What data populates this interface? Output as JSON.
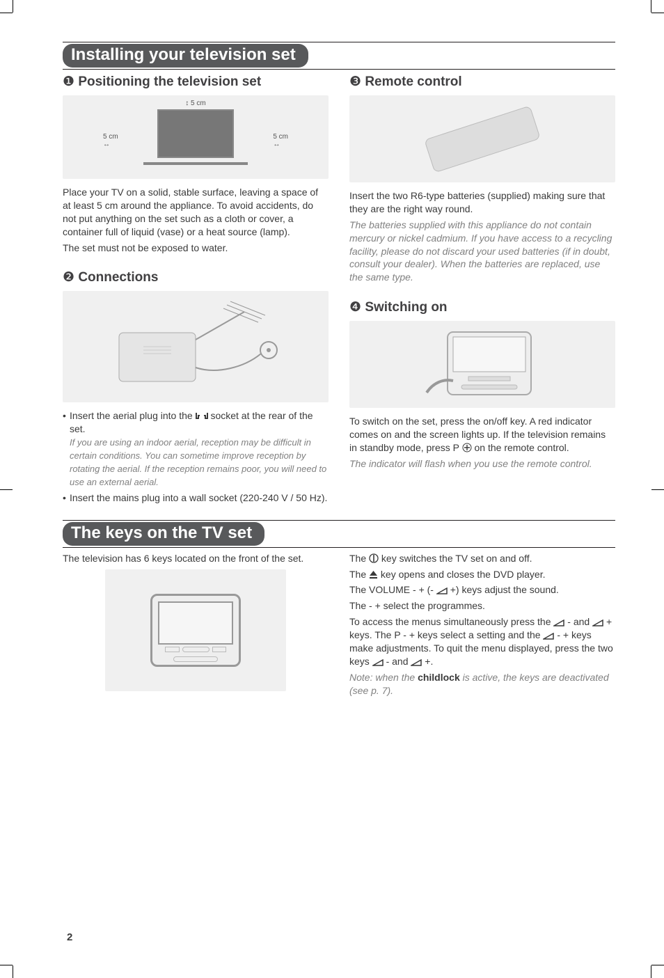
{
  "section1": {
    "title": "Installing your television set",
    "left": {
      "heading_num": "❶",
      "heading": "Positioning the television set",
      "dim_top": "5 cm",
      "dim_left": "5 cm",
      "dim_right": "5 cm",
      "p1": "Place your TV on a solid, stable surface, leaving a space of at least 5 cm around the appliance. To avoid accidents, do not put anything on the set such as a cloth or cover, a container full of liquid (vase) or a heat source (lamp).",
      "p2": "The set must not be exposed to water."
    },
    "left2": {
      "heading_num": "❷",
      "heading": "Connections",
      "b1_a": "Insert the aerial plug into the ",
      "b1_b": " socket at the rear of the set.",
      "b1_italic": "If you are using an indoor aerial, reception may be difficult in certain conditions. You can sometime improve reception by rotating the aerial. If the reception remains poor, you will need to use an external aerial.",
      "b2": "Insert the mains plug into a wall socket (220-240 V / 50 Hz)."
    },
    "right": {
      "heading_num": "❸",
      "heading": "Remote control",
      "p1": "Insert the two R6-type batteries (supplied) making sure that they are the right way round.",
      "p_italic": "The batteries supplied with this appliance do not contain mercury or nickel cadmium. If you have access to a recycling facility, please do not discard your used batteries (if in doubt, consult your dealer). When the batteries are replaced, use the same type."
    },
    "right2": {
      "heading_num": "❹",
      "heading": "Switching on",
      "p1": "To switch on the set, press the on/off key. A red indicator comes on and the screen lights up. If the television remains in standby mode, press P ",
      "p1b": " on the remote control.",
      "p_italic": "The indicator will flash when you use the remote control."
    }
  },
  "section2": {
    "title": "The keys on the TV set",
    "left": {
      "p1": "The television has 6 keys located on the front of the set."
    },
    "right": {
      "l1a": "The ",
      "l1b": " key switches the TV set on and off.",
      "l2a": "The ",
      "l2b": " key opens and closes the DVD player.",
      "l3a": "The VOLUME - + (- ",
      "l3b": "+) keys adjust the sound.",
      "l4": "The - + select the programmes.",
      "l5a": "To access the menus simultaneously press the ",
      "l5b": " - and ",
      "l5c": " + keys. The P - + keys select a setting and the ",
      "l5d": " - + keys make adjustments. To quit the menu displayed, press the two keys ",
      "l5e": " - and ",
      "l5f": " +.",
      "note_a": "Note: when the ",
      "note_bold": "childlock",
      "note_b": " is active, the keys are deactivated (see p. 7)."
    }
  },
  "page": "2"
}
